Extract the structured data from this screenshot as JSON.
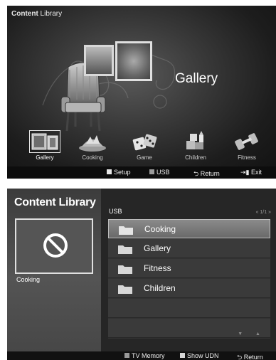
{
  "screen1": {
    "title_bold": "Content ",
    "title_rest": "Library",
    "selected_label": "Gallery",
    "categories": [
      {
        "label": "Gallery",
        "icon": "gallery-icon"
      },
      {
        "label": "Cooking",
        "icon": "cooking-icon"
      },
      {
        "label": "Game",
        "icon": "dice-icon"
      },
      {
        "label": "Children",
        "icon": "blocks-icon"
      },
      {
        "label": "Fitness",
        "icon": "dumbbell-icon"
      }
    ],
    "footer": {
      "setup": "Setup",
      "usb": "USB",
      "return": "Return",
      "exit": "Exit"
    }
  },
  "screen2": {
    "title": "Content Library",
    "preview_label": "Cooking",
    "source": "USB",
    "pager": "« 1/1 »",
    "items": [
      "Cooking",
      "Gallery",
      "Fitness",
      "Children"
    ],
    "selected_index": 0,
    "scroll": "▼ ▲",
    "footer": {
      "tv_memory": "TV Memory",
      "show_udn": "Show UDN",
      "return": "Return"
    }
  },
  "colors": {
    "red_button": "#e8e8e8",
    "green_button": "#9a9a9a",
    "yellow_button": "#d6d6d6"
  }
}
